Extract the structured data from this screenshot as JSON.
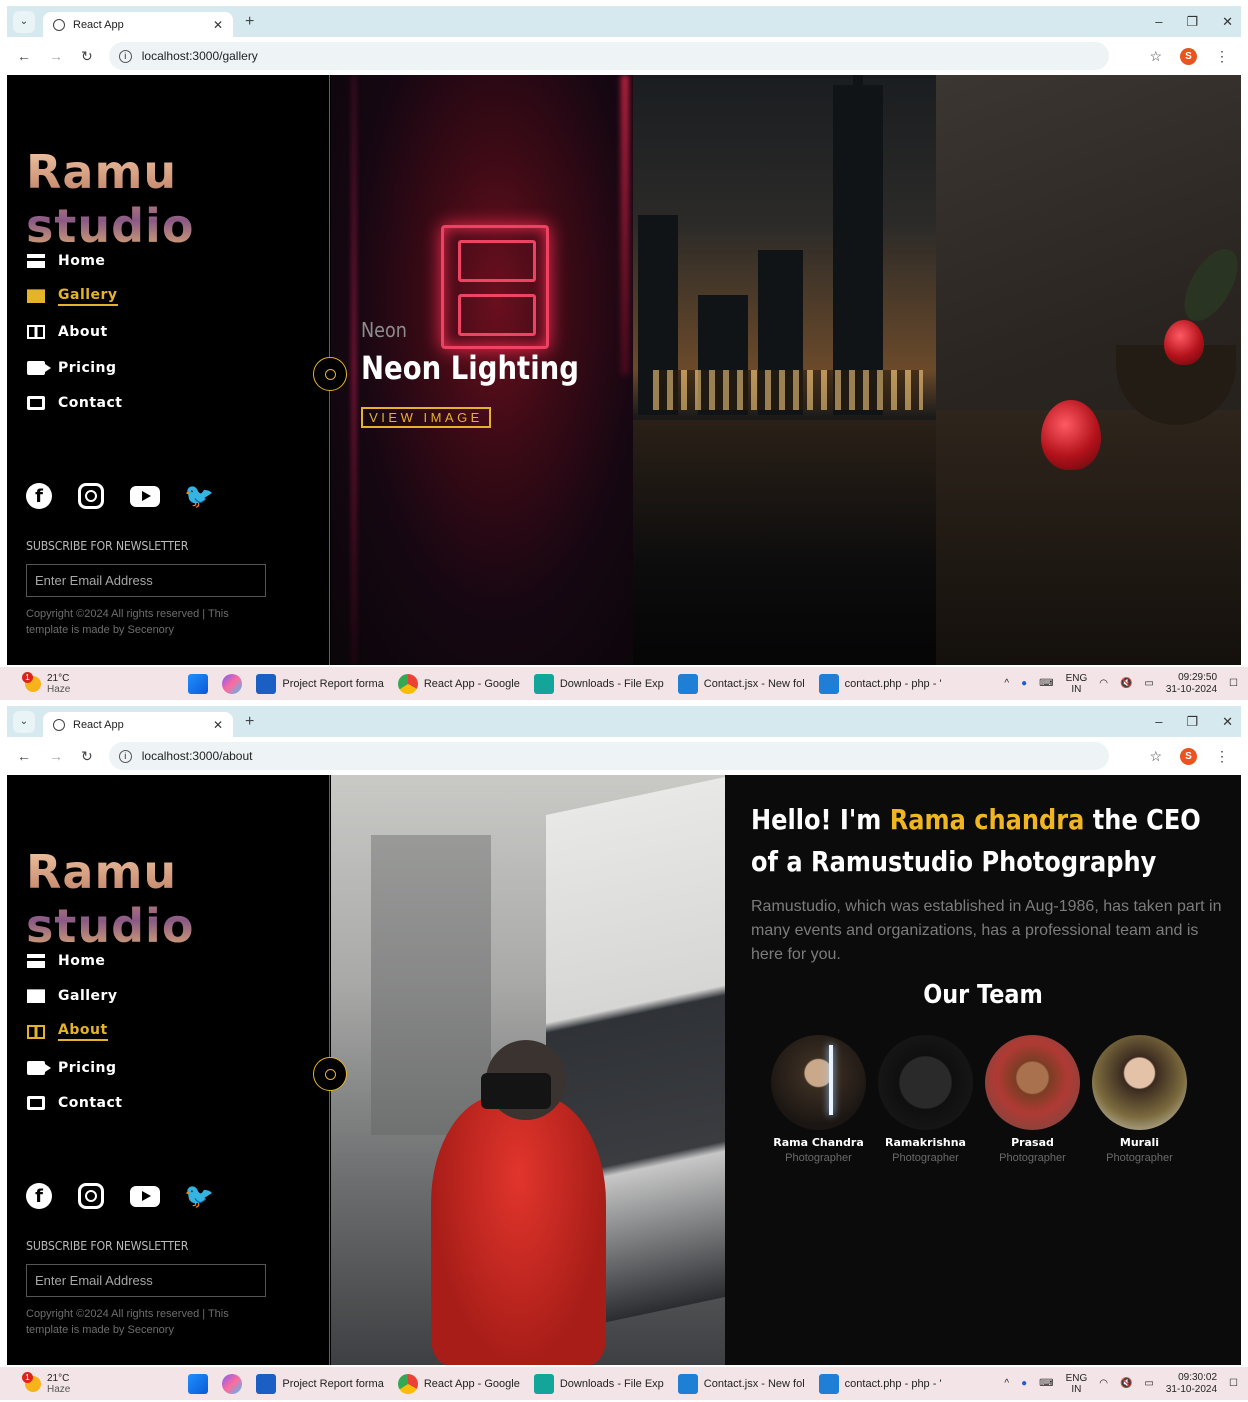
{
  "screenshots": [
    {
      "tab_title": "React App",
      "url": "localhost:3000/gallery",
      "profile_initial": "S",
      "sidebar": {
        "logo": "Ramu studio",
        "menu": [
          {
            "label": "Home",
            "icon": "clapperboard-icon"
          },
          {
            "label": "Gallery",
            "icon": "image-icon",
            "active": true
          },
          {
            "label": "About",
            "icon": "film-icon"
          },
          {
            "label": "Pricing",
            "icon": "video-camera-icon"
          },
          {
            "label": "Contact",
            "icon": "inbox-icon"
          }
        ],
        "newsletter_title": "SUBSCRIBE FOR NEWSLETTER",
        "email_placeholder": "Enter Email Address",
        "copyright": "Copyright ©2024 All rights reserved | This template is made by Secenory"
      },
      "gallery": {
        "caption_small": "Neon",
        "caption_big": "Neon Lighting",
        "button": "VIEW IMAGE"
      },
      "taskbar": {
        "weather_temp": "21°C",
        "weather_desc": "Haze",
        "apps": [
          "Project Report forma",
          "React App - Google",
          "Downloads - File Exp",
          "Contact.jsx - New fol",
          "contact.php - php - '"
        ],
        "lang": "ENG",
        "region": "IN",
        "time": "09:29:50",
        "date": "31-10-2024"
      }
    },
    {
      "tab_title": "React App",
      "url": "localhost:3000/about",
      "profile_initial": "S",
      "sidebar": {
        "logo": "Ramu studio",
        "menu": [
          {
            "label": "Home",
            "icon": "clapperboard-icon"
          },
          {
            "label": "Gallery",
            "icon": "image-icon"
          },
          {
            "label": "About",
            "icon": "film-icon",
            "active": true
          },
          {
            "label": "Pricing",
            "icon": "video-camera-icon"
          },
          {
            "label": "Contact",
            "icon": "inbox-icon"
          }
        ],
        "newsletter_title": "SUBSCRIBE FOR NEWSLETTER",
        "email_placeholder": "Enter Email Address",
        "copyright": "Copyright ©2024 All rights reserved | This template is made by Secenory"
      },
      "about": {
        "hello_pre": "Hello! I'm ",
        "hello_name": "Rama chandra",
        "hello_post": " the CEO of a Ramustudio Photography",
        "description": "Ramustudio, which was established in Aug-1986, has taken part in many events and organizations, has a professional team and is here for you.",
        "team_title": "Our Team",
        "team": [
          {
            "name": "Rama Chandra",
            "role": "Photographer"
          },
          {
            "name": "Ramakrishna",
            "role": "Photographer"
          },
          {
            "name": "Prasad",
            "role": "Photographer"
          },
          {
            "name": "Murali",
            "role": "Photographer"
          }
        ]
      },
      "taskbar": {
        "weather_temp": "21°C",
        "weather_desc": "Haze",
        "apps": [
          "Project Report forma",
          "React App - Google",
          "Downloads - File Exp",
          "Contact.jsx - New fol",
          "contact.php - php - '"
        ],
        "lang": "ENG",
        "region": "IN",
        "time": "09:30:02",
        "date": "31-10-2024"
      }
    }
  ],
  "colors": {
    "accent": "#e5b32a",
    "bg": "#000000",
    "chrome": "#d5e9ef"
  }
}
